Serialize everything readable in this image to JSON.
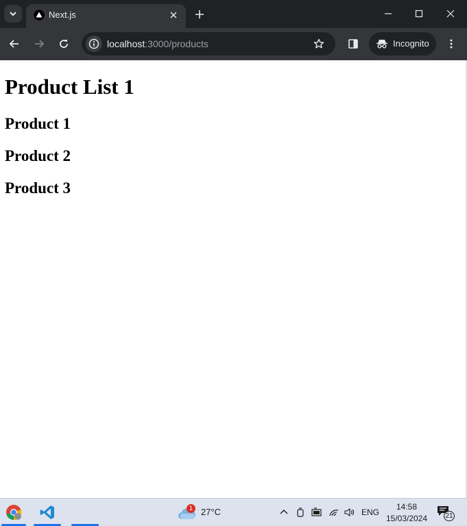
{
  "browser": {
    "tab_title": "Next.js",
    "url_host": "localhost",
    "url_rest": ":3000/products",
    "profile_label": "Incognito"
  },
  "page": {
    "heading": "Product List 1",
    "products": [
      "Product 1",
      "Product 2",
      "Product 3"
    ]
  },
  "taskbar": {
    "weather_badge": "1",
    "weather_temp": "27°C",
    "language": "ENG",
    "time": "14:58",
    "date": "15/03/2024",
    "notification_count": "21"
  },
  "colors": {
    "tabstrip_bg": "#202124",
    "toolbar_bg": "#35363a",
    "taskbar_bg": "#dde3ee",
    "accent": "#1a73e8"
  },
  "icons": {
    "tab_search": "chevron-down-icon",
    "favicon": "nextjs-triangle-icon",
    "back": "arrow-left-icon",
    "forward": "arrow-right-icon",
    "reload": "reload-icon",
    "site_info": "info-icon",
    "bookmark": "star-icon",
    "side_panel": "side-panel-icon",
    "incognito": "incognito-icon",
    "menu": "kebab-menu-icon"
  }
}
